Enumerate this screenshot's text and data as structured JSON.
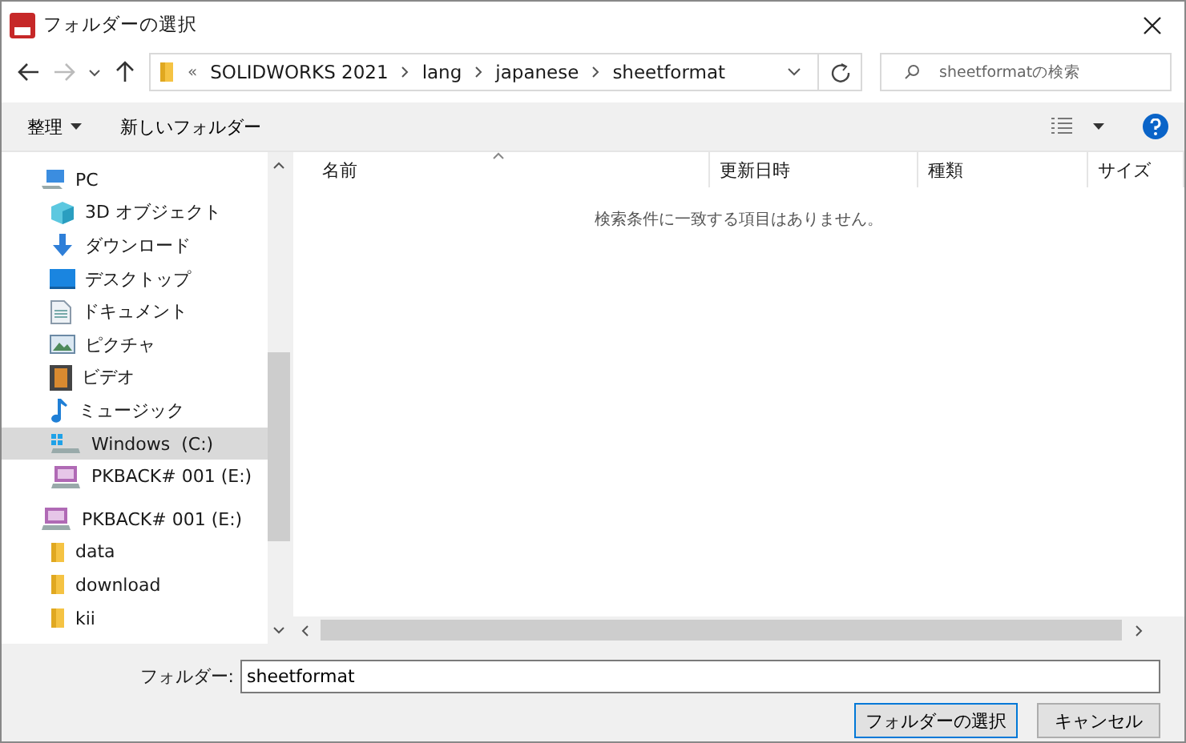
{
  "window": {
    "title": "フォルダーの選択"
  },
  "address": {
    "overflow": "«",
    "crumbs": [
      "SOLIDWORKS 2021",
      "lang",
      "japanese",
      "sheetformat"
    ]
  },
  "search": {
    "placeholder": "sheetformatの検索"
  },
  "toolbar": {
    "organize": "整理",
    "new_folder": "新しいフォルダー"
  },
  "sidebar": {
    "items": [
      {
        "label": "PC",
        "kind": "pc",
        "selected": false,
        "children": [
          {
            "label": "3D オブジェクト",
            "kind": "cube",
            "selected": false
          },
          {
            "label": "ダウンロード",
            "kind": "download",
            "selected": false
          },
          {
            "label": "デスクトップ",
            "kind": "desktop",
            "selected": false
          },
          {
            "label": "ドキュメント",
            "kind": "document",
            "selected": false
          },
          {
            "label": "ピクチャ",
            "kind": "pictures",
            "selected": false
          },
          {
            "label": "ビデオ",
            "kind": "video",
            "selected": false
          },
          {
            "label": "ミュージック",
            "kind": "music",
            "selected": false
          },
          {
            "label": "Windows  (C:)",
            "kind": "windows-drive",
            "selected": true
          },
          {
            "label": "PKBACK# 001 (E:)",
            "kind": "sd-drive",
            "selected": false
          }
        ]
      },
      {
        "label": "PKBACK# 001 (E:)",
        "kind": "sd-drive",
        "selected": false,
        "children": [
          {
            "label": "data",
            "kind": "folder",
            "selected": false
          },
          {
            "label": "download",
            "kind": "folder",
            "selected": false
          },
          {
            "label": "kii",
            "kind": "folder",
            "selected": false
          }
        ]
      }
    ]
  },
  "table": {
    "columns": [
      "名前",
      "更新日時",
      "種類",
      "サイズ"
    ],
    "empty_message": "検索条件に一致する項目はありません。"
  },
  "folder_field": {
    "label": "フォルダー:",
    "value": "sheetformat"
  },
  "buttons": [
    {
      "label": "フォルダーの選択",
      "kind": "primary"
    },
    {
      "label": "キャンセル",
      "kind": "normal"
    }
  ]
}
